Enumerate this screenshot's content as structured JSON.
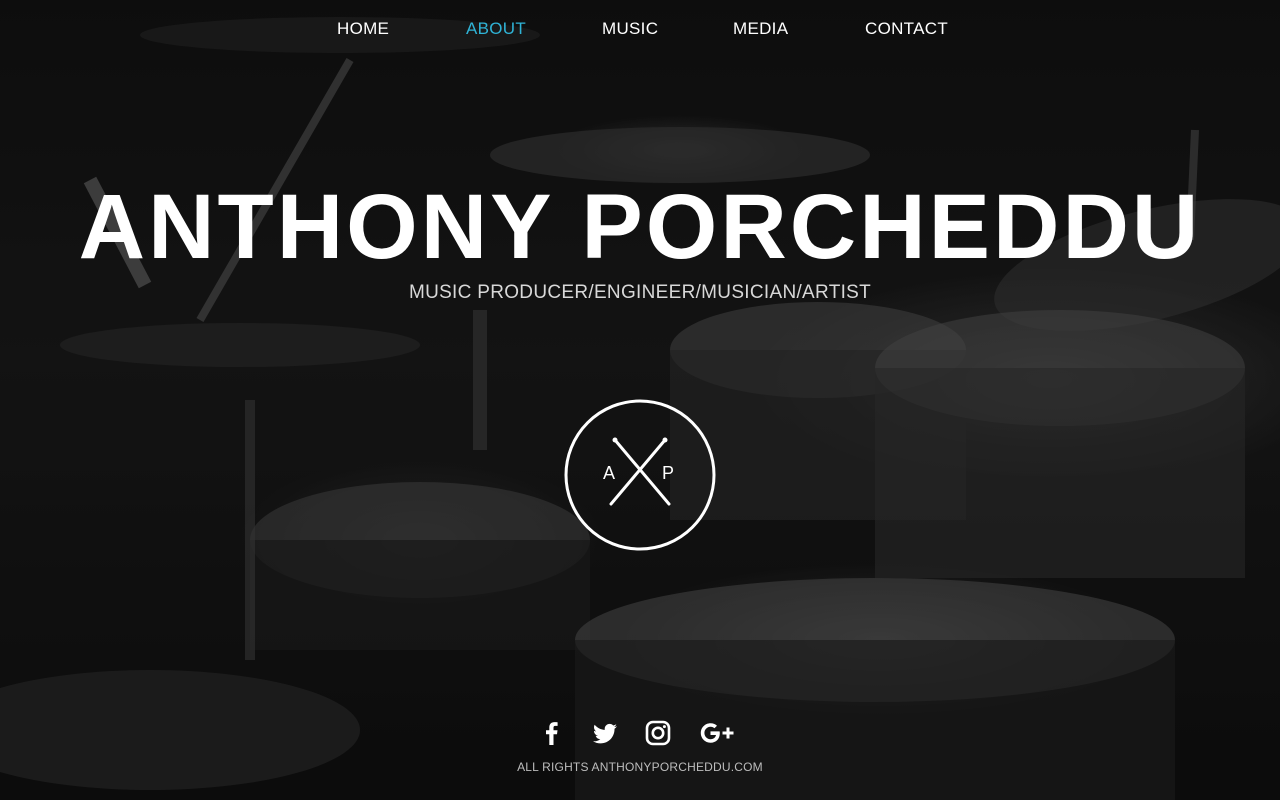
{
  "nav": {
    "items": [
      {
        "label": "HOME"
      },
      {
        "label": "ABOUT"
      },
      {
        "label": "MUSIC"
      },
      {
        "label": "MEDIA"
      },
      {
        "label": "CONTACT"
      }
    ],
    "active_item": "ABOUT",
    "active_color": "#2fb3d6"
  },
  "hero": {
    "title": "ANTHONY PORCHEDDU",
    "subtitle": "MUSIC PRODUCER/ENGINEER/MUSICIAN/ARTIST"
  },
  "logo": {
    "left_letter": "A",
    "right_letter": "P"
  },
  "social": {
    "icons": [
      "facebook-icon",
      "twitter-icon",
      "instagram-icon",
      "google-plus-icon"
    ]
  },
  "footer": {
    "copyright": "ALL RIGHTS ANTHONYPORCHEDDU.COM"
  },
  "colors": {
    "text": "#ffffff",
    "accent": "#2fb3d6",
    "background": "#121212"
  }
}
